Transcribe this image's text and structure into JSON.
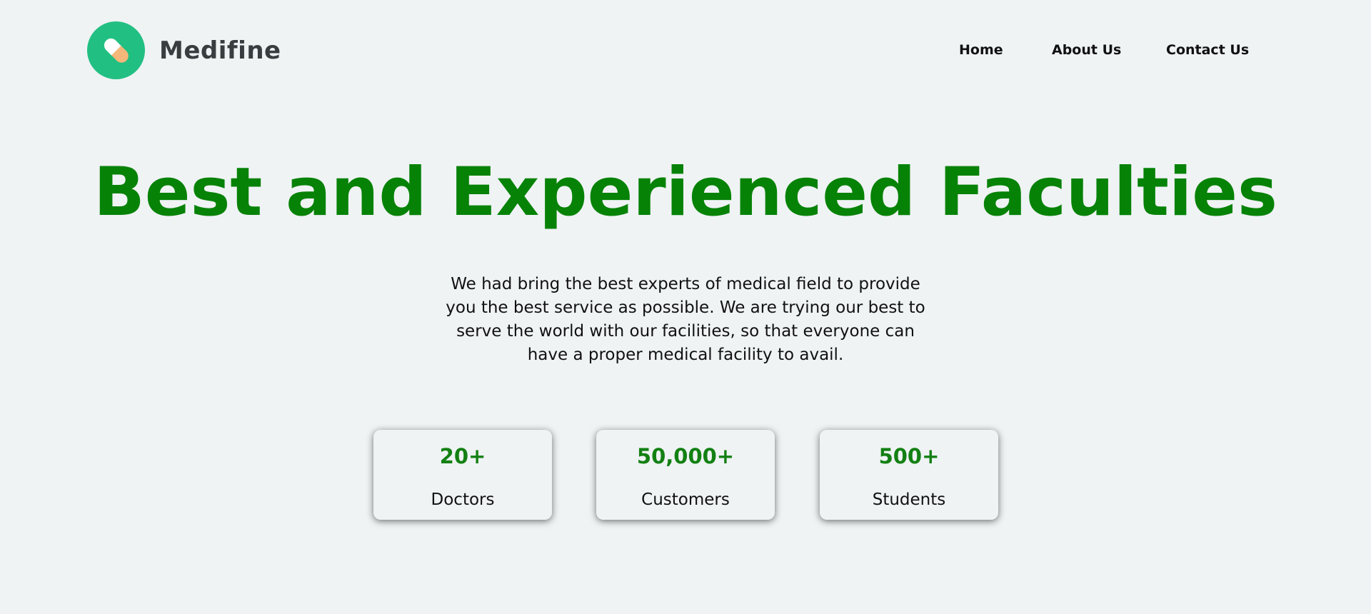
{
  "brand": {
    "name": "Medifine",
    "logo_icon": "pill-icon",
    "logo_color": "#22bf82",
    "pill_color_top": "#ffffff",
    "pill_color_bottom": "#f6b77a"
  },
  "nav": {
    "items": [
      {
        "label": "Home"
      },
      {
        "label": "About Us"
      },
      {
        "label": "Contact Us"
      }
    ]
  },
  "hero": {
    "title": "Best and Experienced Faculties",
    "title_color": "#068206",
    "description": "We had bring the best experts of medical field to provide you the best service as possible. We are trying our best to serve the world with our facilities, so that everyone can have a proper medical facility to avail."
  },
  "stats": [
    {
      "value": "20+",
      "label": "Doctors"
    },
    {
      "value": "50,000+",
      "label": "Customers"
    },
    {
      "value": "500+",
      "label": "Students"
    }
  ]
}
